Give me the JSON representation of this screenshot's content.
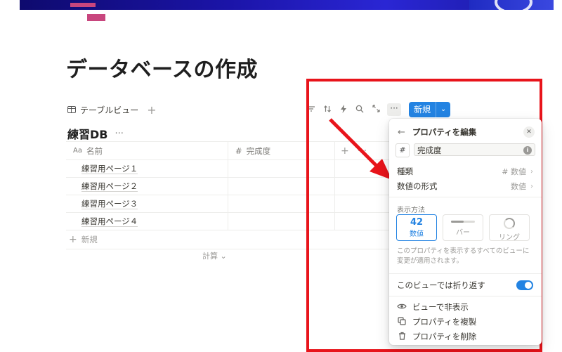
{
  "page": {
    "title": "データベースの作成"
  },
  "view_tab": {
    "label": "テーブルビュー",
    "add": "+"
  },
  "toolbar": {
    "more": "···",
    "new_label": "新規",
    "new_caret": "⌄"
  },
  "database": {
    "title": "練習DB",
    "menu": "···",
    "columns": {
      "name_prefix": "Aa",
      "name": "名前",
      "number_prefix": "#",
      "number": "完成度",
      "add": "+",
      "more": "···"
    },
    "rows": [
      "練習用ページ１",
      "練習用ページ２",
      "練習用ページ３",
      "練習用ページ４"
    ],
    "new_row": "新規",
    "calc": "計算 ⌄"
  },
  "panel": {
    "back": "←",
    "title": "プロパティを編集",
    "close": "✕",
    "type_symbol": "#",
    "name_value": "完成度",
    "info": "i",
    "type_label": "種類",
    "type_value": "# 数値",
    "format_label": "数値の形式",
    "format_value": "数値",
    "chevron": "›",
    "display_label": "表示方法",
    "display_options": [
      {
        "icon_text": "42",
        "label": "数値",
        "selected": true
      },
      {
        "label": "バー",
        "selected": false
      },
      {
        "label": "リング",
        "selected": false
      }
    ],
    "note": "このプロパティを表示するすべてのビューに変更が適用されます。",
    "wrap_label": "このビューでは折り返す",
    "wrap_on": true,
    "actions": [
      {
        "icon": "eye-icon",
        "glyph": "◉",
        "label": "ビューで非表示"
      },
      {
        "icon": "duplicate-icon",
        "glyph": "⧉",
        "label": "プロパティを複製"
      },
      {
        "icon": "trash-icon",
        "glyph": "🗑",
        "label": "プロパティを削除"
      }
    ]
  },
  "colors": {
    "accent": "#2383e2",
    "highlight": "#e8141b",
    "page_icon": "#c8467e"
  }
}
